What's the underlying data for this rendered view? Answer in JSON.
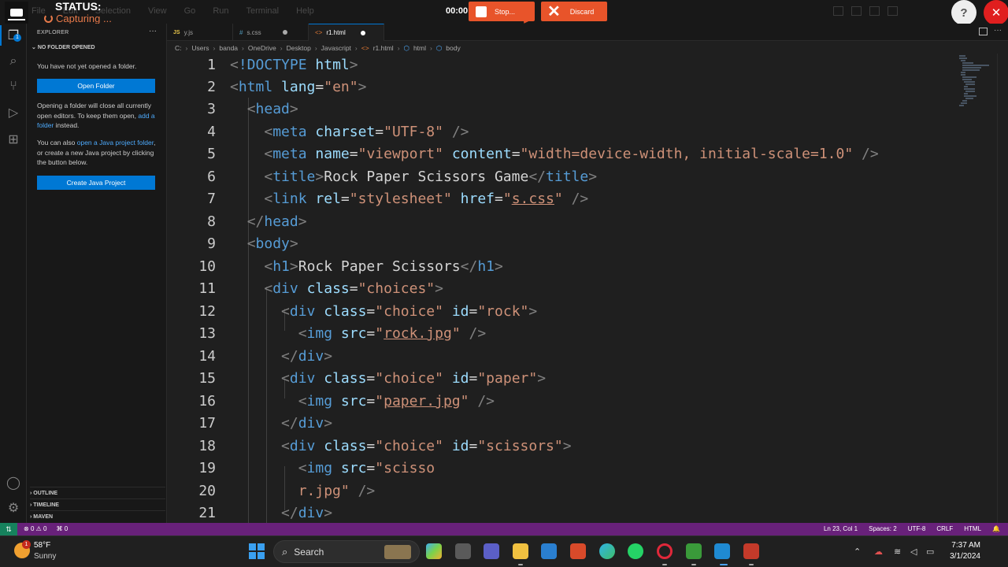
{
  "recorder": {
    "status_label": "STATUS:",
    "status_value": "Capturing ...",
    "timer": "00:00",
    "stop_label": "Stop...",
    "discard_label": "Discard",
    "help_label": "?"
  },
  "menu": [
    "File",
    "Edit",
    "Selection",
    "View",
    "Go",
    "Run",
    "Terminal",
    "Help"
  ],
  "sidebar": {
    "title": "EXPLORER",
    "section": "NO FOLDER OPENED",
    "msg1": "You have not yet opened a folder.",
    "open_folder": "Open Folder",
    "msg2_pre": "Opening a folder will close all currently open editors. To keep them open,",
    "msg2_link": "add a folder",
    "msg2_post": "instead.",
    "msg3_pre": "You can also",
    "msg3_link": "open a Java project folder",
    "msg3_post": ", or create a new Java project by clicking the button below.",
    "create_java": "Create Java Project",
    "outline": "OUTLINE",
    "timeline": "TIMELINE",
    "maven": "MAVEN"
  },
  "tabs": [
    {
      "icon": "JS",
      "label": "y.js"
    },
    {
      "icon": "#",
      "label": "s.css"
    },
    {
      "icon": "<>",
      "label": "r1.html"
    }
  ],
  "breadcrumb": [
    "C:",
    "Users",
    "banda",
    "OneDrive",
    "Desktop",
    "Javascript",
    "r1.html",
    "html",
    "body"
  ],
  "editor": {
    "line_numbers": [
      "1",
      "2",
      "3",
      "4",
      "5",
      "6",
      "7",
      "8",
      "9",
      "10",
      "11",
      "12",
      "13",
      "14",
      "15",
      "16",
      "17",
      "18",
      "19",
      "20",
      "21"
    ]
  },
  "statusbar": {
    "errors": "0",
    "warnings": "0",
    "ports": "0",
    "position": "Ln 23, Col 1",
    "spaces": "Spaces: 2",
    "encoding": "UTF-8",
    "eol": "CRLF",
    "language": "HTML"
  },
  "taskbar": {
    "weather_temp": "58°F",
    "weather_cond": "Sunny",
    "weather_badge": "1",
    "search_placeholder": "Search",
    "time": "7:37 AM",
    "date": "3/1/2024"
  },
  "colors": {
    "status_bar": "#68217a",
    "accent": "#0078d4",
    "recorder": "#e8542a"
  }
}
